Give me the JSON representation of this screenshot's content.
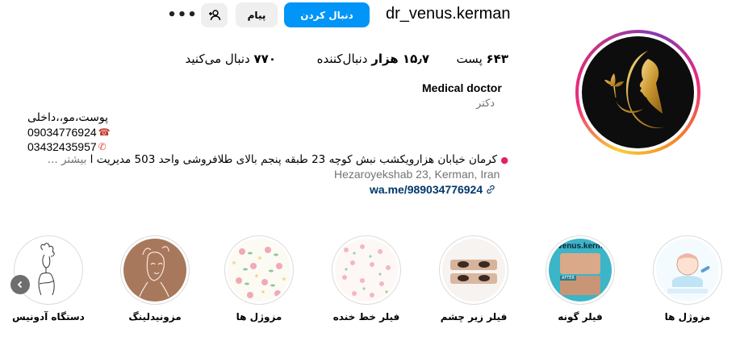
{
  "header": {
    "username": "dr_venus.kerman",
    "follow_label": "دنبال کردن",
    "message_label": "پیام",
    "more_label": "•••"
  },
  "stats": {
    "posts_value": "۶۴۳",
    "posts_label": "پست",
    "followers_value": "۱۵٫۷ هزار",
    "followers_label": "دنبال‌کننده",
    "following_value": "۷۷۰",
    "following_label": "دنبال می‌کنید"
  },
  "profile": {
    "full_name": "Medical doctor",
    "category": "دکتر",
    "bio_line1": "پوست،مو،،داخلی",
    "phone1": "09034776924",
    "phone2": "03432435957",
    "address": "کرمان خیابان هزارویکشب نبش کوچه 23 طبقه پنجم بالای طلافروشی واحد 503 مدیریت ا",
    "more_label": "بیشتر ...",
    "map_location": "Hezaroyekshab 23, Kerman, Iran",
    "link": "wa.me/989034776924"
  },
  "highlights": [
    {
      "label": "مزوژل ها",
      "icon": "face-care-illustration"
    },
    {
      "label": "فیلر گونه",
      "icon": "before-after-cheek"
    },
    {
      "label": "فیلر زیر چشم",
      "icon": "eyes-photo"
    },
    {
      "label": "فیلر خط خنده",
      "icon": "floral-pattern"
    },
    {
      "label": "مزوژل ها",
      "icon": "floral-pattern-2"
    },
    {
      "label": "مزونیدلینگ",
      "icon": "face-line-art"
    },
    {
      "label": "دستگاه آدونیس",
      "icon": "woman-sketch"
    }
  ],
  "highlight_overlay_text": "venus.kerm",
  "highlight_overlay_after": "AFTER",
  "colors": {
    "follow_button": "#0095f6",
    "secondary_button": "#efefef",
    "link": "#00376b",
    "muted": "#737373"
  }
}
